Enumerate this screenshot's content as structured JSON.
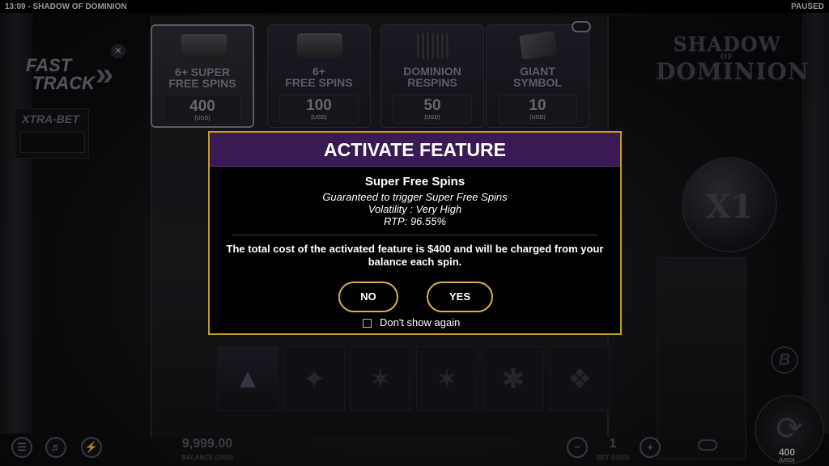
{
  "topbar": {
    "left": "13:09 - SHADOW OF DOMINION",
    "right": "PAUSED"
  },
  "fast_track": {
    "line1": "FAST",
    "line2": "TRACK",
    "chevrons": "»",
    "close": "×"
  },
  "xtra_bet": {
    "label": "XTRA-BET"
  },
  "features": [
    {
      "title_l1": "6+ SUPER",
      "title_l2": "FREE SPINS",
      "price": "400",
      "currency": "(USD)"
    },
    {
      "title_l1": "6+",
      "title_l2": "FREE SPINS",
      "price": "100",
      "currency": "(USD)"
    },
    {
      "title_l1": "DOMINION",
      "title_l2": "RESPINS",
      "price": "50",
      "currency": "(USD)"
    },
    {
      "title_l1": "GIANT",
      "title_l2": "SYMBOL",
      "price": "10",
      "currency": "(USD)"
    }
  ],
  "logo": {
    "l1": "SHADOW",
    "l2": "OF",
    "l3": "DOMINION"
  },
  "multiplier": "X1",
  "brand_badge": "B",
  "bottom": {
    "balance_value": "9,999.00",
    "balance_label": "BALANCE (USD)",
    "bet_value": "1",
    "bet_label": "BET (USD)",
    "minus": "−",
    "plus": "+",
    "stake_value": "400",
    "stake_label": "(USD)"
  },
  "modal": {
    "title": "ACTIVATE FEATURE",
    "feature_name": "Super Free Spins",
    "description": "Guaranteed to trigger Super Free Spins",
    "volatility": "Volatility : Very High",
    "rtp": "RTP: 96.55%",
    "cost_text": "The total cost of the activated feature is $400 and will be charged from your balance each spin.",
    "no_label": "NO",
    "yes_label": "YES",
    "dont_show_label": "Don't show again",
    "dont_show_checked": false
  },
  "colors": {
    "modal_border": "#c29b2c",
    "modal_header": "#3a1a55",
    "button_border": "#d9b14a"
  }
}
